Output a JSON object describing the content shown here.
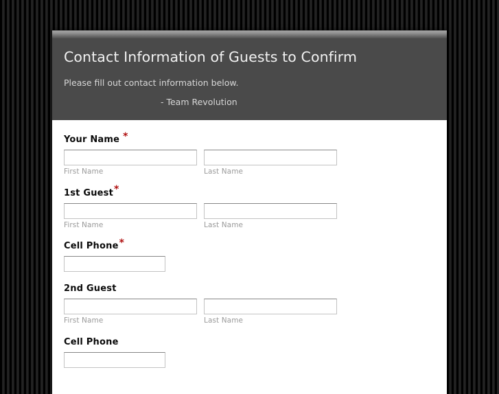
{
  "background": {
    "pattern": "vertical-stripes",
    "color_dark": "#000000",
    "color_light": "#232323"
  },
  "theme": {
    "header_bg": "#4a4a4a",
    "header_highlight": "#a6a6a6",
    "panel_bg": "#ffffff",
    "required_star_color": "#b01010",
    "sublabel_color": "#9a9a9a",
    "input_border": "#c2c2c2",
    "input_border_top": "#868686"
  },
  "header": {
    "title": "Contact Information of Guests to Confirm",
    "subtitle": "Please fill out contact information below.",
    "signature": "- Team Revolution"
  },
  "form": {
    "rows": [
      {
        "id": "your-name",
        "label": "Your Name",
        "required": true,
        "star_spacing": "spaced",
        "type": "name",
        "fields": [
          {
            "id": "your-name-first",
            "sub_label": "First Name",
            "value": "",
            "placeholder": ""
          },
          {
            "id": "your-name-last",
            "sub_label": "Last Name",
            "value": "",
            "placeholder": ""
          }
        ]
      },
      {
        "id": "guest-1",
        "label": "1st Guest",
        "required": true,
        "star_spacing": "tight",
        "type": "name",
        "fields": [
          {
            "id": "guest-1-first",
            "sub_label": "First Name",
            "value": "",
            "placeholder": ""
          },
          {
            "id": "guest-1-last",
            "sub_label": "Last Name",
            "value": "",
            "placeholder": ""
          }
        ]
      },
      {
        "id": "guest-1-cell-phone",
        "label": "Cell Phone",
        "required": true,
        "star_spacing": "tight",
        "type": "phone",
        "fields": [
          {
            "id": "guest-1-phone",
            "sub_label": "",
            "value": "",
            "placeholder": ""
          }
        ]
      },
      {
        "id": "guest-2",
        "label": "2nd Guest",
        "required": false,
        "star_spacing": "",
        "type": "name",
        "fields": [
          {
            "id": "guest-2-first",
            "sub_label": "First Name",
            "value": "",
            "placeholder": ""
          },
          {
            "id": "guest-2-last",
            "sub_label": "Last Name",
            "value": "",
            "placeholder": ""
          }
        ]
      },
      {
        "id": "guest-2-cell-phone",
        "label": "Cell Phone",
        "required": false,
        "star_spacing": "",
        "type": "phone",
        "fields": [
          {
            "id": "guest-2-phone",
            "sub_label": "",
            "value": "",
            "placeholder": ""
          }
        ]
      }
    ],
    "required_marker": "*"
  }
}
